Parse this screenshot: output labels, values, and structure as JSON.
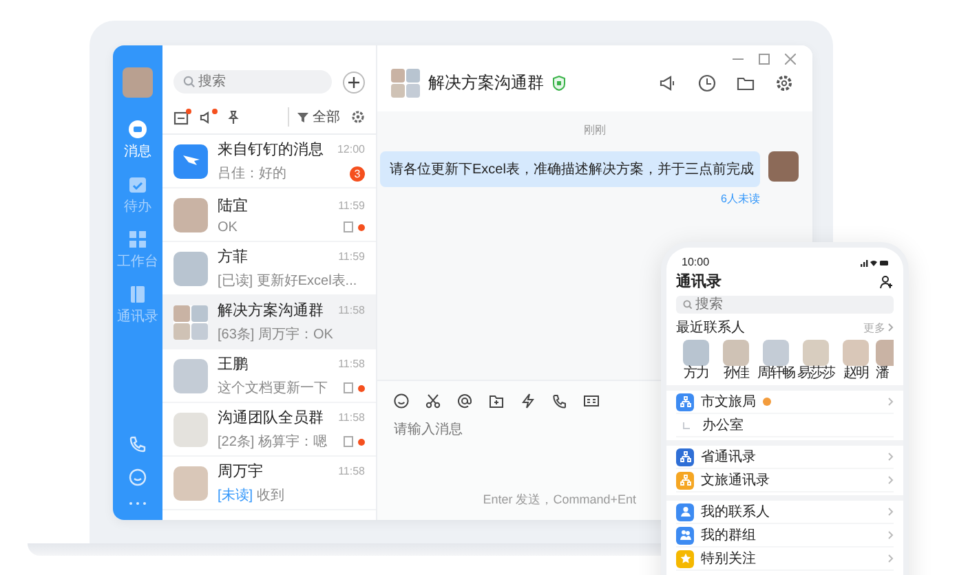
{
  "sidebar": {
    "items": [
      {
        "label": "消息",
        "kind": "chat",
        "selected": true
      },
      {
        "label": "待办",
        "kind": "todo",
        "selected": false
      },
      {
        "label": "工作台",
        "kind": "grid",
        "selected": false
      },
      {
        "label": "通讯录",
        "kind": "book",
        "selected": false
      }
    ]
  },
  "conversations": {
    "search": {
      "placeholder": "搜索"
    },
    "filters": [
      {
        "kind": "inbox",
        "dot": true
      },
      {
        "kind": "mute",
        "dot": true
      },
      {
        "kind": "pin",
        "dot": false
      }
    ],
    "filter": "全部",
    "items": [
      {
        "name": "来自钉钉的消息",
        "preview": "吕佳：好的",
        "time": "12:00",
        "kind": "app",
        "badge": "3",
        "read_icon": false,
        "dot": false,
        "selected": false
      },
      {
        "name": "陆宜",
        "preview": "OK",
        "time": "11:59",
        "kind": "photo",
        "read_icon": true,
        "dot": true,
        "selected": false
      },
      {
        "name": "方菲",
        "preview": "[已读] 更新好Excel表...",
        "time": "11:59",
        "kind": "photo",
        "read_icon": false,
        "dot": false,
        "selected": false
      },
      {
        "name": "解决方案沟通群",
        "preview": "[63条] 周万宇：OK",
        "time": "11:58",
        "kind": "group",
        "read_icon": false,
        "dot": false,
        "selected": true
      },
      {
        "name": "王鹏",
        "preview": "这个文档更新一下",
        "time": "11:58",
        "kind": "photo",
        "read_icon": true,
        "dot": true,
        "selected": false
      },
      {
        "name": "沟通团队全员群",
        "preview": "[22条] 杨算宇：嗯",
        "time": "11:58",
        "kind": "note",
        "read_icon": true,
        "dot": true,
        "selected": false
      },
      {
        "name": "周万宇",
        "tag": "[未读]",
        "preview": "收到",
        "time": "11:58",
        "kind": "photo",
        "read_icon": false,
        "dot": false,
        "selected": false
      }
    ]
  },
  "chat": {
    "title": "解决方案沟通群",
    "verified": true,
    "messages": [
      {
        "kind": "time",
        "text": "刚刚"
      },
      {
        "kind": "mine",
        "text": "请各位更新下Excel表，准确描述解决方案，并于三点前完成",
        "receipt": "6人未读"
      }
    ],
    "tools": [
      {
        "kind": "emoji"
      },
      {
        "kind": "scissors"
      },
      {
        "kind": "at"
      },
      {
        "kind": "folder"
      },
      {
        "kind": "bolt"
      },
      {
        "kind": "phone"
      },
      {
        "kind": "card"
      }
    ],
    "input": {
      "placeholder": "请输入消息"
    },
    "hint": "Enter 发送，Command+Ent"
  },
  "phone": {
    "time": "10:00",
    "title": "通讯录",
    "search": {
      "placeholder": "搜索"
    },
    "recent": {
      "title": "最近联系人",
      "more": "更多",
      "contacts": [
        {
          "name": "方力"
        },
        {
          "name": "孙佳"
        },
        {
          "name": "周轩畅"
        },
        {
          "name": "易莎莎"
        },
        {
          "name": "赵明"
        },
        {
          "name": "潘"
        }
      ]
    },
    "groups": [
      {
        "rows": [
          {
            "label": "市文旅局",
            "kind": "org",
            "color": "#3d8bf2",
            "badge": true
          },
          {
            "label": "办公室",
            "kind": "sub",
            "color": "#c8ccd2",
            "badge": false
          }
        ]
      },
      {
        "rows": [
          {
            "label": "省通讯录",
            "kind": "org",
            "color": "#2f6fd6",
            "badge": false
          },
          {
            "label": "文旅通讯录",
            "kind": "org",
            "color": "#f5a623",
            "badge": false
          }
        ]
      },
      {
        "rows": [
          {
            "label": "我的联系人",
            "kind": "person",
            "color": "#3d8bf2",
            "badge": false
          },
          {
            "label": "我的群组",
            "kind": "group",
            "color": "#3d8bf2",
            "badge": false
          },
          {
            "label": "特别关注",
            "kind": "star",
            "color": "#f5b800",
            "badge": false
          }
        ]
      }
    ]
  }
}
